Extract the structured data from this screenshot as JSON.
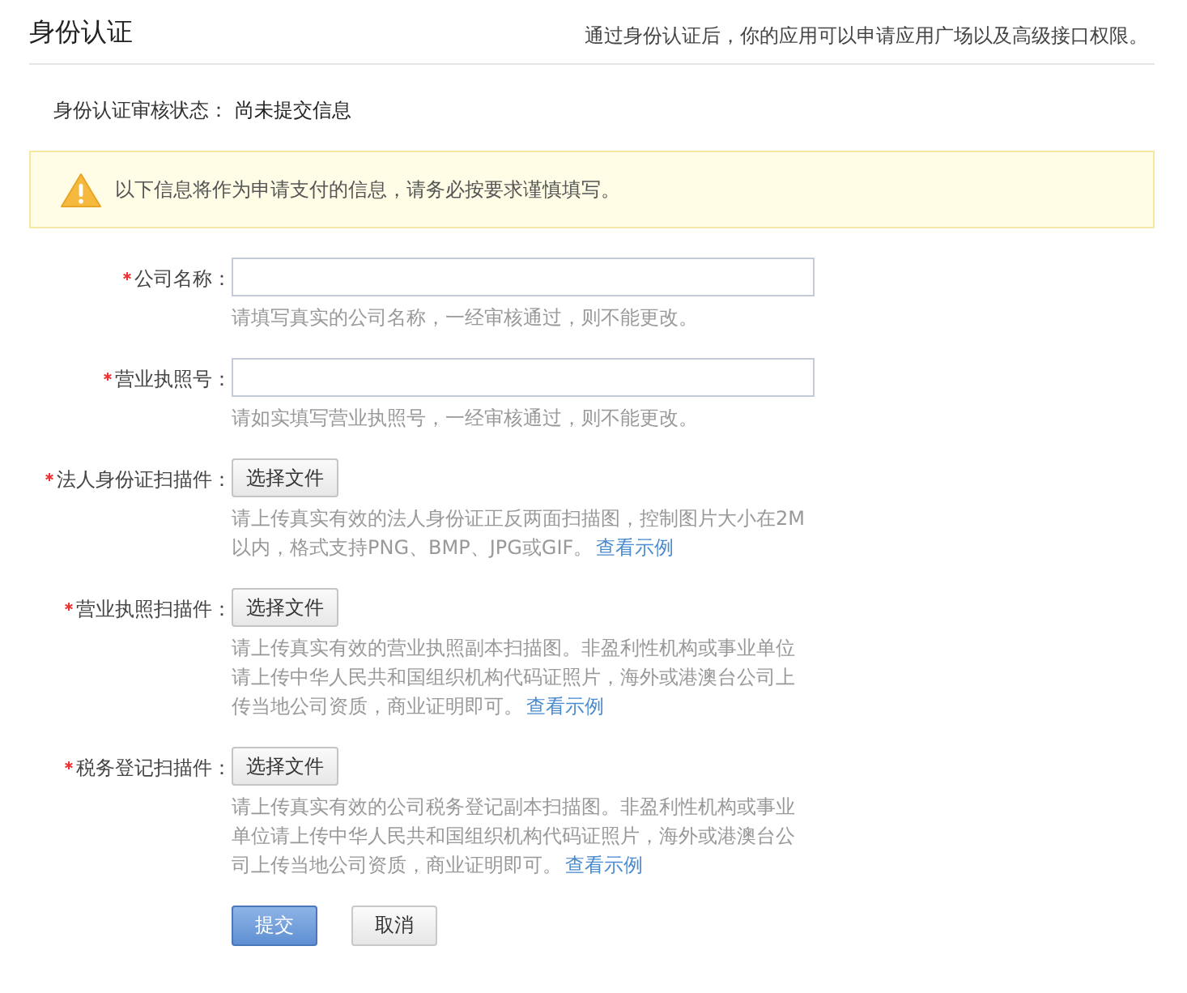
{
  "header": {
    "title": "身份认证",
    "note": "通过身份认证后，你的应用可以申请应用广场以及高级接口权限。"
  },
  "status": {
    "label": "身份认证审核状态：",
    "value": "尚未提交信息"
  },
  "warning": {
    "text": "以下信息将作为申请支付的信息，请务必按要求谨慎填写。"
  },
  "fields": [
    {
      "kind": "text",
      "required": true,
      "label": "公司名称：",
      "hint": "请填写真实的公司名称，一经审核通过，则不能更改。"
    },
    {
      "kind": "text",
      "required": true,
      "label": "营业执照号：",
      "hint": "请如实填写营业执照号，一经审核通过，则不能更改。"
    },
    {
      "kind": "file",
      "required": true,
      "label": "法人身份证扫描件：",
      "button": "选择文件",
      "hint": "请上传真实有效的法人身份证正反两面扫描图，控制图片大小在2M以内，格式支持PNG、BMP、JPG或GIF。",
      "link": "查看示例"
    },
    {
      "kind": "file",
      "required": true,
      "label": "营业执照扫描件：",
      "button": "选择文件",
      "hint": "请上传真实有效的营业执照副本扫描图。非盈利性机构或事业单位请上传中华人民共和国组织机构代码证照片，海外或港澳台公司上传当地公司资质，商业证明即可。",
      "link": "查看示例"
    },
    {
      "kind": "file",
      "required": true,
      "label": "税务登记扫描件：",
      "button": "选择文件",
      "hint": "请上传真实有效的公司税务登记副本扫描图。非盈利性机构或事业单位请上传中华人民共和国组织机构代码证照片，海外或港澳台公司上传当地公司资质，商业证明即可。",
      "link": "查看示例"
    }
  ],
  "actions": [
    {
      "kind": "primary",
      "label": "提交"
    },
    {
      "kind": "secondary",
      "label": "取消"
    }
  ]
}
